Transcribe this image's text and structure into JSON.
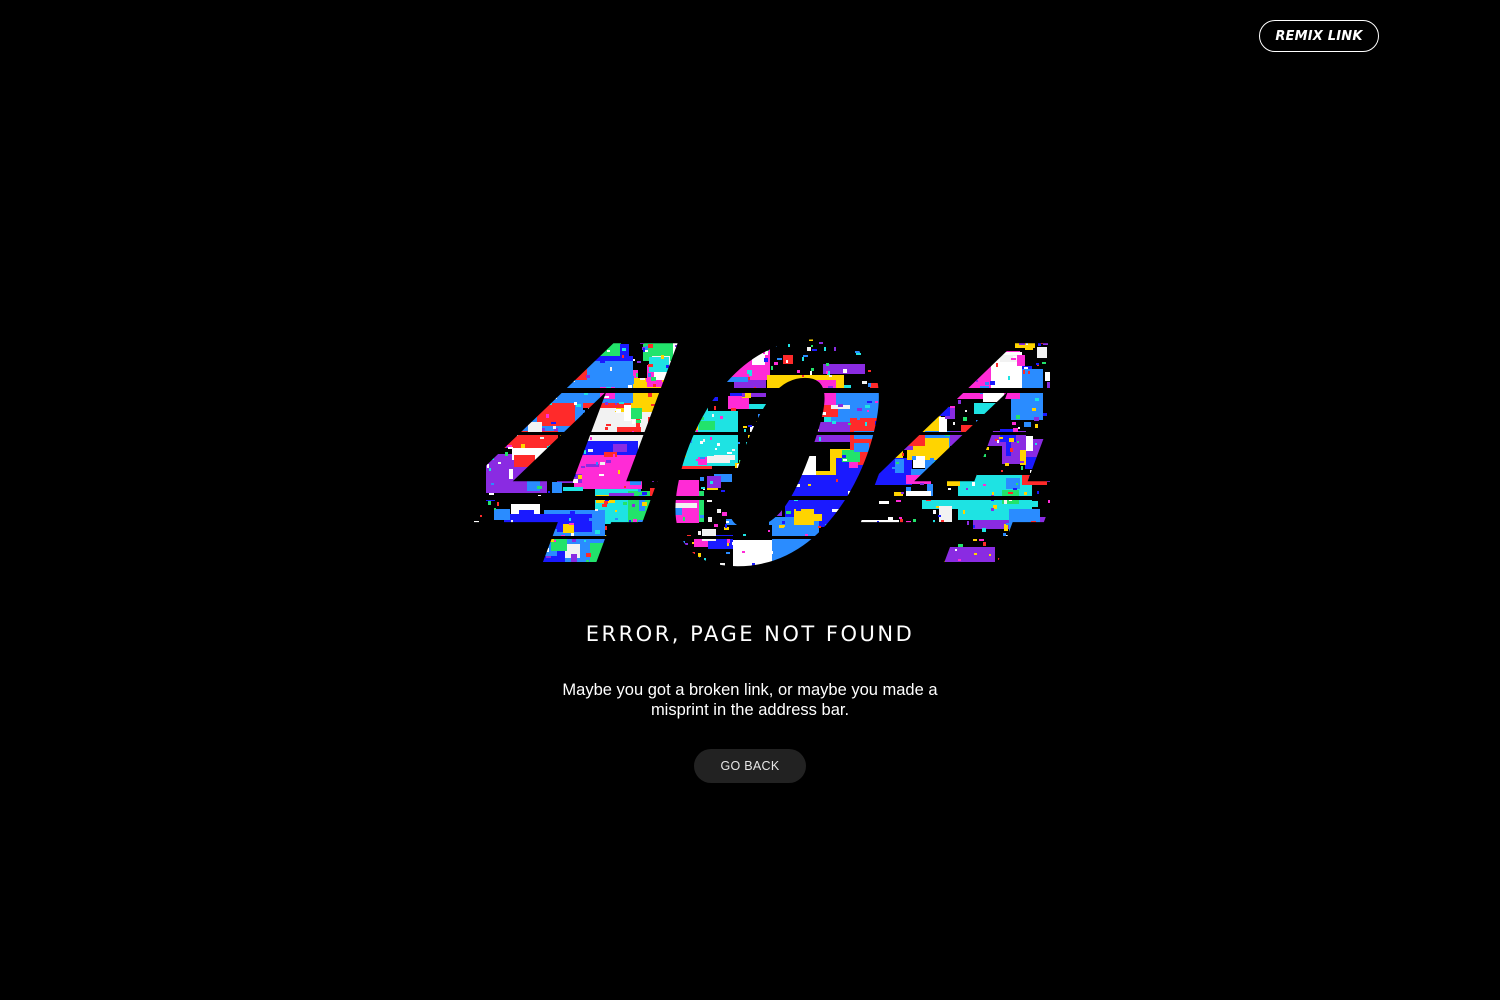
{
  "header": {
    "remix_label": "REMIX LINK"
  },
  "hero": {
    "code": "404",
    "glitch_palette": [
      "#ff2bd6",
      "#22e36b",
      "#2a8cff",
      "#f2f2f2",
      "#8a2be2",
      "#ffd400",
      "#ff2a2a",
      "#1ee3e3",
      "#1a1aff",
      "#ffffff"
    ]
  },
  "main": {
    "title": "ERROR, PAGE NOT FOUND",
    "description": "Maybe you got a broken link, or maybe you made a misprint in the address bar.",
    "back_label": "GO BACK"
  },
  "colors": {
    "background": "#000000",
    "text": "#ffffff",
    "button_bg": "#222222"
  }
}
